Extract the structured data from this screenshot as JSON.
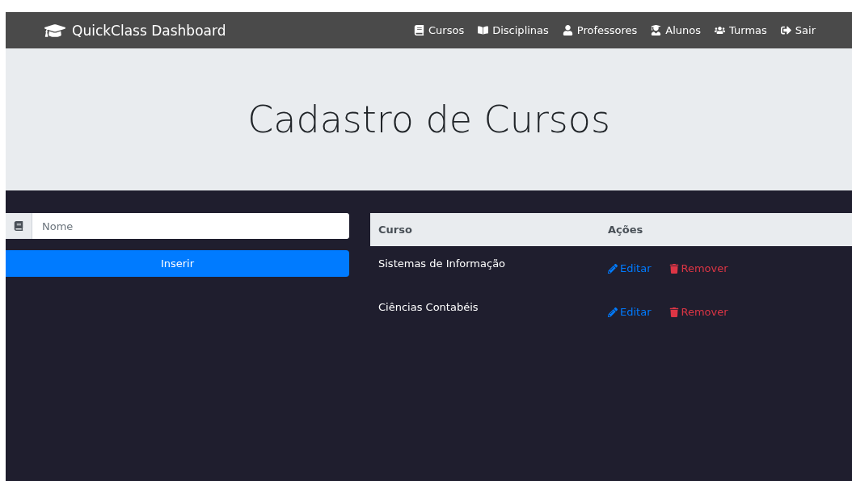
{
  "navbar": {
    "brand": "QuickClass Dashboard",
    "links": [
      {
        "kind": "cursos",
        "label": "Cursos"
      },
      {
        "kind": "disciplinas",
        "label": "Disciplinas"
      },
      {
        "kind": "professores",
        "label": "Professores"
      },
      {
        "kind": "alunos",
        "label": "Alunos"
      },
      {
        "kind": "turmas",
        "label": "Turmas"
      },
      {
        "kind": "sair",
        "label": "Sair"
      }
    ]
  },
  "header": {
    "title": "Cadastro de Cursos"
  },
  "form": {
    "placeholder": "Nome",
    "button": "Inserir"
  },
  "table": {
    "columns": [
      "Curso",
      "Ações"
    ],
    "rows": [
      {
        "curso": "Sistemas de Informação",
        "edit": "Editar",
        "remove": "Remover"
      },
      {
        "curso": "Ciências Contabéis",
        "edit": "Editar",
        "remove": "Remover"
      }
    ]
  }
}
